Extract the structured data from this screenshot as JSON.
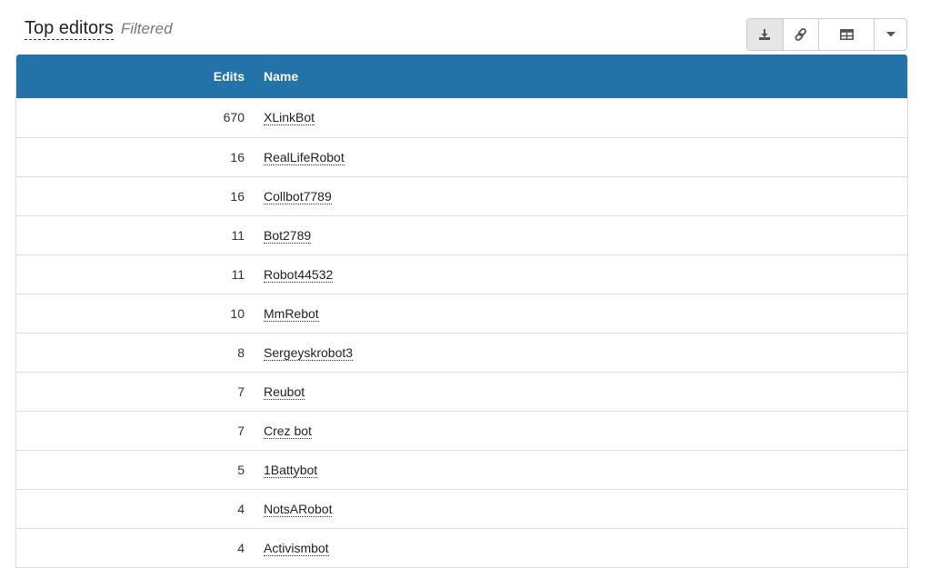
{
  "header": {
    "title": "Top editors",
    "subtitle": "Filtered"
  },
  "toolbar": {
    "buttons": [
      "download-icon",
      "link-icon",
      "table-icon",
      "caret-down-icon"
    ]
  },
  "colors": {
    "table_header_bg": "#2372a8",
    "active_button_bg": "#e6e6e6"
  },
  "table": {
    "columns": [
      "Edits",
      "Name"
    ],
    "rows": [
      {
        "edits": "670",
        "name": "XLinkBot"
      },
      {
        "edits": "16",
        "name": "RealLifeRobot"
      },
      {
        "edits": "16",
        "name": "Collbot7789"
      },
      {
        "edits": "11",
        "name": "Bot2789"
      },
      {
        "edits": "11",
        "name": "Robot44532"
      },
      {
        "edits": "10",
        "name": "MmRebot"
      },
      {
        "edits": "8",
        "name": "Sergeyskrobot3"
      },
      {
        "edits": "7",
        "name": "Reubot"
      },
      {
        "edits": "7",
        "name": "Crez bot"
      },
      {
        "edits": "5",
        "name": "1Battybot"
      },
      {
        "edits": "4",
        "name": "NotsARobot"
      },
      {
        "edits": "4",
        "name": "Activismbot"
      }
    ]
  }
}
